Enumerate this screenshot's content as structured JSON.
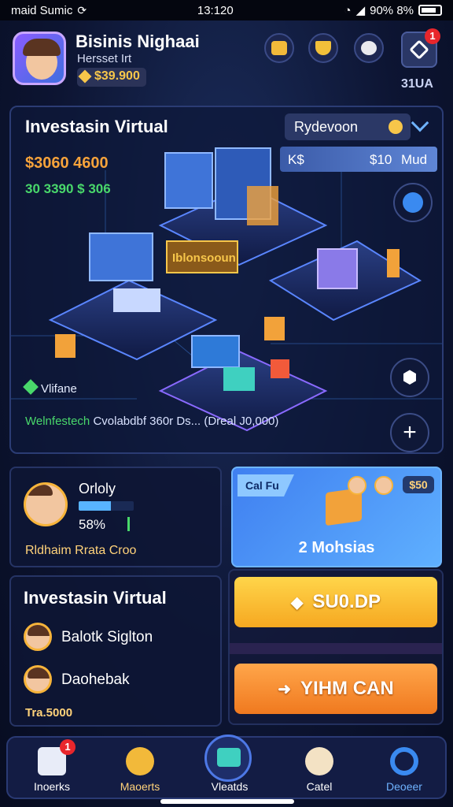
{
  "status_bar": {
    "carrier": "maid Sumic",
    "time": "13:120",
    "battery_text": "90% 8%"
  },
  "header": {
    "title": "Bisinis Nighaai",
    "subtitle": "Hersset Irt",
    "balance": "$39.900",
    "notification_count": "1",
    "code_label": "31UA"
  },
  "main_panel": {
    "title": "Investasin Virtual",
    "dropdown_label": "Rydevoon",
    "stat_primary": "$3060  4600",
    "stat_secondary": "30 3390 $ 306",
    "market_bar": {
      "left": "K$",
      "mid": "$10",
      "right": "Mud"
    },
    "sign_text": "Iblonsooun",
    "asset_label": "Vlifane",
    "footer_green": "Welnfestech",
    "footer_rest": "Cvolabdbf 360r Ds...  (Dreal J0,000)",
    "add_symbol": "+"
  },
  "progress_card": {
    "name": "Orloly",
    "progress_fraction": 0.58,
    "percent_text": "58%",
    "caption": "Rldhaim Rrata Croo"
  },
  "promo_card": {
    "tag": "Cal Fu",
    "count": "$50",
    "label": "2 Mohsias"
  },
  "list_card": {
    "title": "Investasin Virtual",
    "items": [
      {
        "label": "Balotk Siglton"
      },
      {
        "label": "Daohebak"
      }
    ],
    "amount": "Tra.5000"
  },
  "buttons": {
    "primary": "SU0.DP",
    "secondary": "YIHM CAN",
    "primary_icon": "◆",
    "secondary_icon": "➜"
  },
  "bottom_nav": {
    "items": [
      {
        "label": "Inoerks",
        "badge": "1"
      },
      {
        "label": "Maoerts"
      },
      {
        "label": "Vleatds"
      },
      {
        "label": "Catel"
      },
      {
        "label": "Deoeer"
      }
    ]
  },
  "colors": {
    "accent": "#4d78e6",
    "gold": "#f7c64a",
    "green": "#49d86b",
    "orange": "#f7a33b",
    "alert": "#e8262c"
  }
}
